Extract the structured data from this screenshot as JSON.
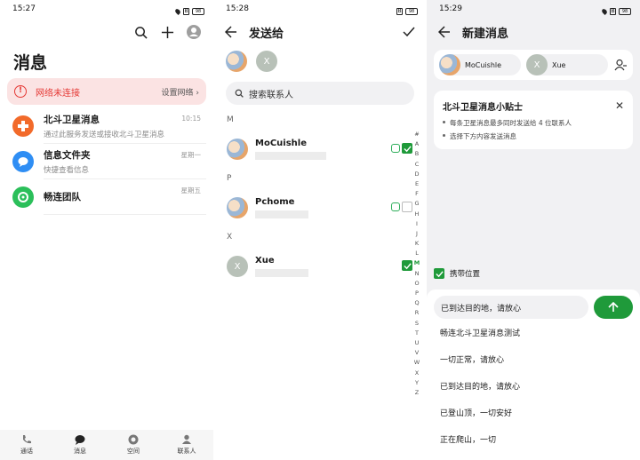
{
  "s1": {
    "time": "15:27",
    "battery": "98",
    "title": "消息",
    "network": {
      "text": "网络未连接",
      "action": "设置网络"
    },
    "conversations": [
      {
        "name": "北斗卫星消息",
        "sub": "通过此服务发送或接收北斗卫星消息",
        "time": "10:15",
        "color": "#f26a2a"
      },
      {
        "name": "信息文件夹",
        "sub": "快捷查看信息",
        "time": "星期一",
        "color": "#2f8ef4"
      },
      {
        "name": "畅连团队",
        "sub": "",
        "time": "星期五",
        "color": "#2bbf5a"
      }
    ],
    "nav": [
      "通话",
      "消息",
      "空间",
      "联系人"
    ]
  },
  "s2": {
    "time": "15:28",
    "battery": "98",
    "title": "发送给",
    "selected_initial": "X",
    "search_placeholder": "搜索联系人",
    "sections": [
      {
        "letter": "M",
        "name": "MoCuishle",
        "checked": true,
        "initial": ""
      },
      {
        "letter": "P",
        "name": "Pchome",
        "checked": false,
        "initial": ""
      },
      {
        "letter": "X",
        "name": "Xue",
        "checked": true,
        "initial": "X"
      }
    ],
    "alphabet": [
      "#",
      "A",
      "B",
      "C",
      "D",
      "E",
      "F",
      "G",
      "H",
      "I",
      "J",
      "K",
      "L",
      "M",
      "N",
      "O",
      "P",
      "Q",
      "R",
      "S",
      "T",
      "U",
      "V",
      "W",
      "X",
      "Y",
      "Z"
    ],
    "current_letter": "M"
  },
  "s3": {
    "time": "15:29",
    "battery": "98",
    "title": "新建消息",
    "recipients": [
      {
        "name": "MoCuishle",
        "initial": ""
      },
      {
        "name": "Xue",
        "initial": "X"
      }
    ],
    "tips": {
      "title": "北斗卫星消息小贴士",
      "items": [
        "每条卫星消息最多同时发送给 4 位联系人",
        "选择下方内容发送消息"
      ]
    },
    "location_label": "携带位置",
    "input_text": "已到达目的地，请放心",
    "quick_replies": [
      "畅连北斗卫星消息测试",
      "一切正常，请放心",
      "已到达目的地，请放心",
      "已登山顶，一切安好",
      "正在爬山，一切"
    ]
  }
}
